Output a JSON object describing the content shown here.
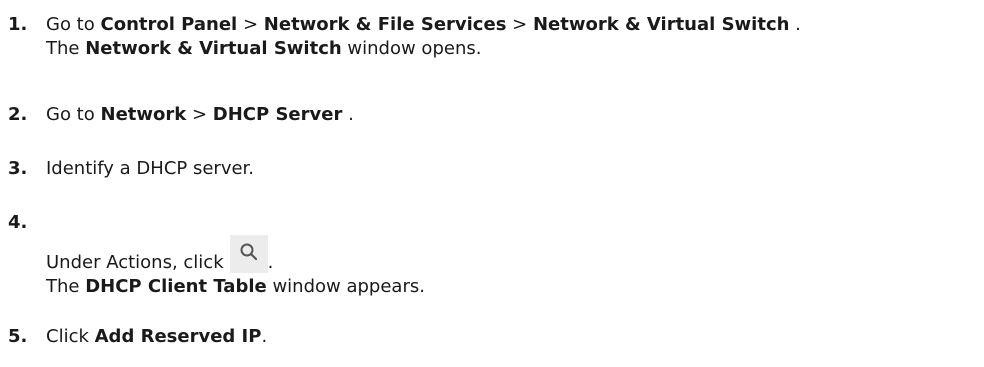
{
  "steps": [
    {
      "number": "1.",
      "prefix": "Go to",
      "path1": "Control Panel",
      "sep1": ">",
      "path2": "Network & File Services",
      "sep2": ">",
      "path3": "Network & Virtual Switch",
      "end": ".",
      "result_prefix": "The",
      "result_bold": "Network & Virtual Switch",
      "result_suffix": "window opens."
    },
    {
      "number": "2.",
      "prefix": "Go to",
      "path1": "Network",
      "sep1": ">",
      "path2": "DHCP Server",
      "end": "."
    },
    {
      "number": "3.",
      "text": "Identify a DHCP server."
    },
    {
      "number": "4.",
      "text": "Under Actions, click",
      "icon": "search-icon",
      "end": ".",
      "result_prefix": "The",
      "result_bold": "DHCP Client Table",
      "result_suffix": "window appears."
    },
    {
      "number": "5.",
      "prefix": "Click",
      "bold": "Add Reserved IP",
      "end": "."
    }
  ]
}
